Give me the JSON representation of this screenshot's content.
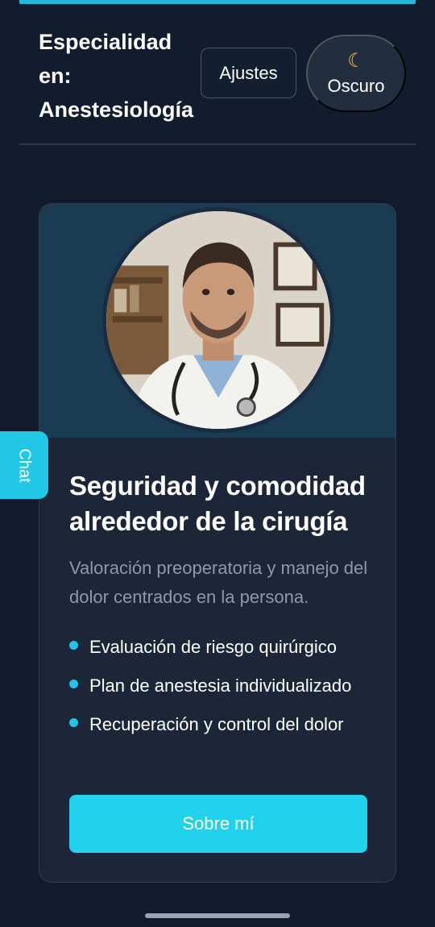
{
  "header": {
    "title": "Especialidad en: Anestesiología",
    "settings_label": "Ajustes",
    "dark_mode": {
      "icon": "moon-icon",
      "label": "Oscuro"
    }
  },
  "card": {
    "title": "Seguridad y comodidad alrededor de la cirugía",
    "description": "Valoración preoperatoria y manejo del dolor centrados en la persona.",
    "features": [
      "Evaluación de riesgo quirúrgico",
      "Plan de anestesia individualizado",
      "Recuperación y control del dolor"
    ],
    "button_label": "Sobre mí"
  },
  "chat_tab": {
    "label": "Chat"
  },
  "colors": {
    "background": "#121b2d",
    "card": "#1d2638",
    "accent": "#22d2ec",
    "hero": "#1a3b52",
    "muted_text": "#8d98aa"
  }
}
